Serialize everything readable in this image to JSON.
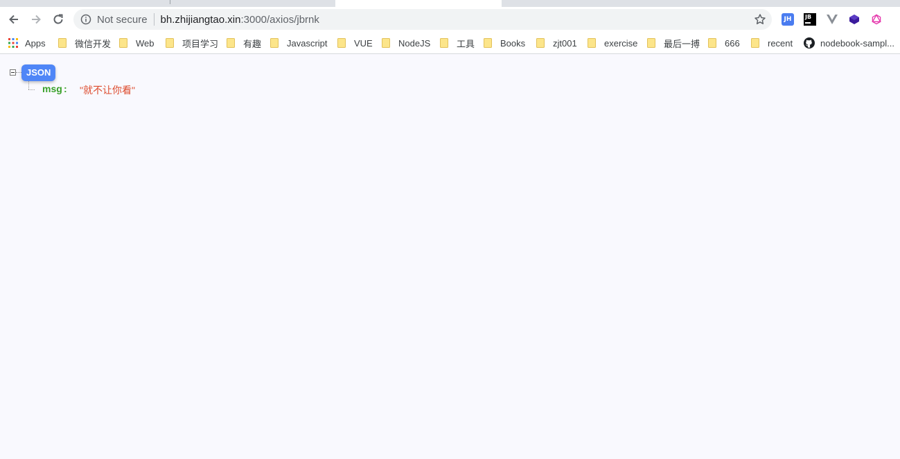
{
  "browser": {
    "security_label": "Not secure",
    "url_host": "bh.zhijiangtao.xin",
    "url_rest": ":3000/axios/jbrnk"
  },
  "extensions": {
    "jh_label": "JH",
    "jb_label": "JB"
  },
  "bookmarks": [
    {
      "label": "Apps",
      "icon": "apps-grid-icon"
    },
    {
      "label": "微信开发",
      "icon": "folder-icon"
    },
    {
      "label": "Web",
      "icon": "folder-icon"
    },
    {
      "label": "项目学习",
      "icon": "folder-icon"
    },
    {
      "label": "有趣",
      "icon": "folder-icon"
    },
    {
      "label": "Javascript",
      "icon": "folder-icon"
    },
    {
      "label": "VUE",
      "icon": "folder-icon"
    },
    {
      "label": "NodeJS",
      "icon": "folder-icon"
    },
    {
      "label": "工具",
      "icon": "folder-icon"
    },
    {
      "label": "Books",
      "icon": "folder-icon"
    },
    {
      "label": "zjt001",
      "icon": "folder-icon"
    },
    {
      "label": "exercise",
      "icon": "folder-icon"
    },
    {
      "label": "最后一搏",
      "icon": "folder-icon"
    },
    {
      "label": "666",
      "icon": "folder-icon"
    },
    {
      "label": "recent",
      "icon": "folder-icon"
    },
    {
      "label": "nodebook-sampl...",
      "icon": "github-icon"
    }
  ],
  "json_viewer": {
    "root_label": "JSON",
    "entries": [
      {
        "key": "msg",
        "separator": ":",
        "value": "\"就不让你看\""
      }
    ]
  },
  "colors": {
    "badge": "#4f86f7",
    "key": "#3aa12a",
    "string_value": "#dd4a2c",
    "page_bg": "#f9f9fe"
  }
}
